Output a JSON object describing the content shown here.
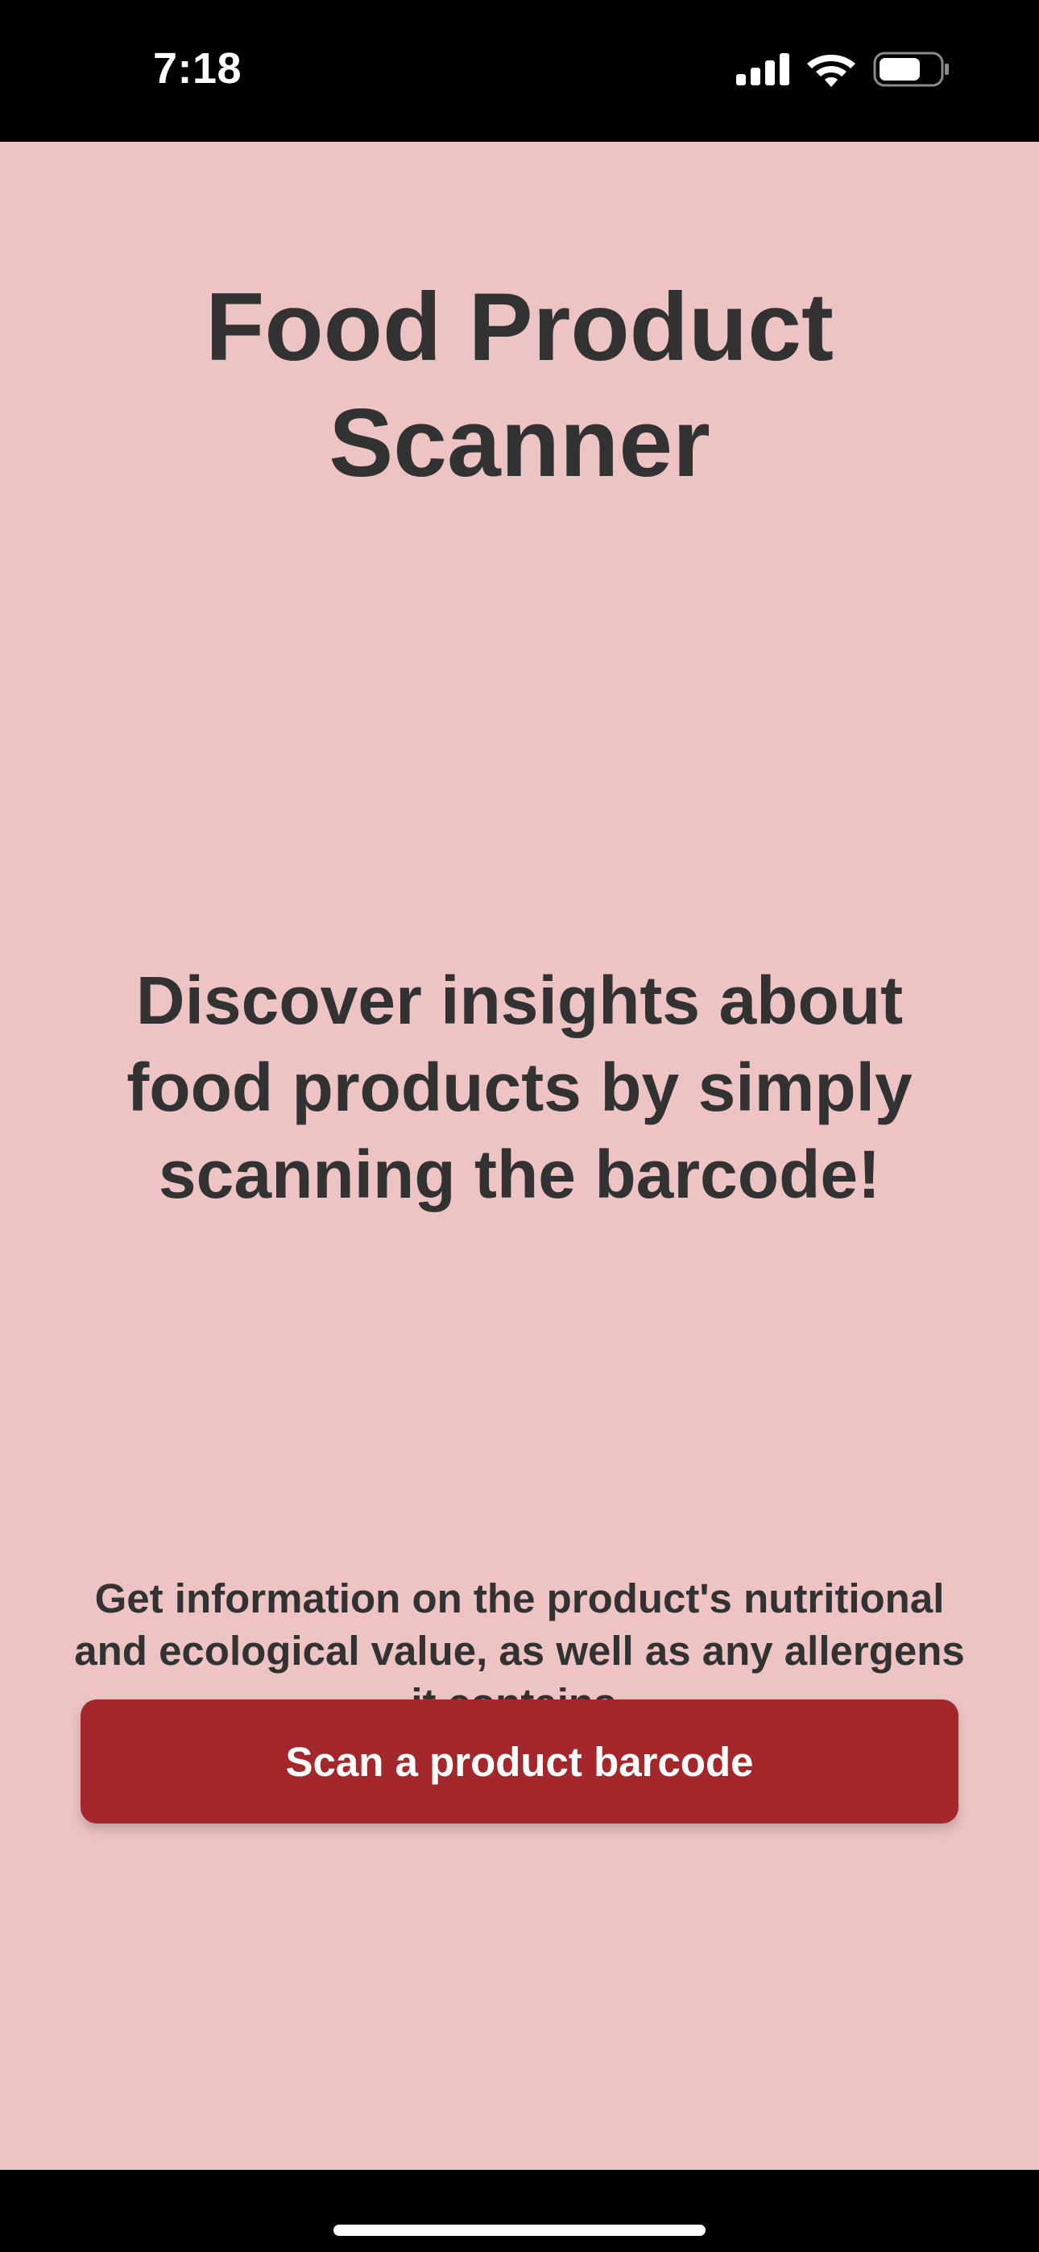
{
  "status_bar": {
    "time": "7:18",
    "signal_icon": "cellular-signal-icon",
    "wifi_icon": "wifi-icon",
    "battery_icon": "battery-icon",
    "battery_level": 0.7
  },
  "main": {
    "title": "Food Product\nScanner",
    "tagline": "Discover insights about food products by simply scanning the barcode!",
    "description": "Get information on the product's nutritional and ecological value, as well as any allergens it contains.",
    "scan_button_label": "Scan a product barcode"
  },
  "colors": {
    "background": "#edc4c3",
    "text": "#333232",
    "button": "#a4282b",
    "button_text": "#ffffff"
  }
}
